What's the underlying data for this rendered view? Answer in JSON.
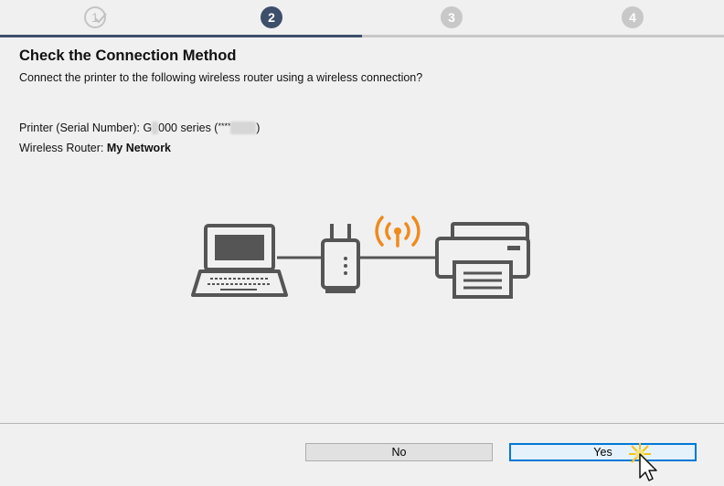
{
  "steps": [
    {
      "label": "1",
      "state": "done"
    },
    {
      "label": "2",
      "state": "active"
    },
    {
      "label": "3",
      "state": "todo"
    },
    {
      "label": "4",
      "state": "todo"
    }
  ],
  "progress": 0.5,
  "title": "Check the Connection Method",
  "subtitle": "Connect the printer to the following wireless router using a wireless connection?",
  "printer": {
    "label": "Printer (Serial Number): ",
    "model_prefix": "G",
    "model_hidden": "2",
    "model_suffix": "000 series (",
    "serial_visible": "****",
    "serial_hidden": "1234",
    "close": ")"
  },
  "router": {
    "label": "Wireless Router: ",
    "name": "My Network"
  },
  "icons": {
    "laptop": "laptop-icon",
    "router": "router-icon",
    "signal": "wireless-signal-icon",
    "printer": "printer-icon"
  },
  "colors": {
    "accent": "#3d4f6b",
    "signal": "#f08a1c",
    "primary_border": "#0078d7"
  },
  "buttons": {
    "no": "No",
    "yes": "Yes"
  }
}
